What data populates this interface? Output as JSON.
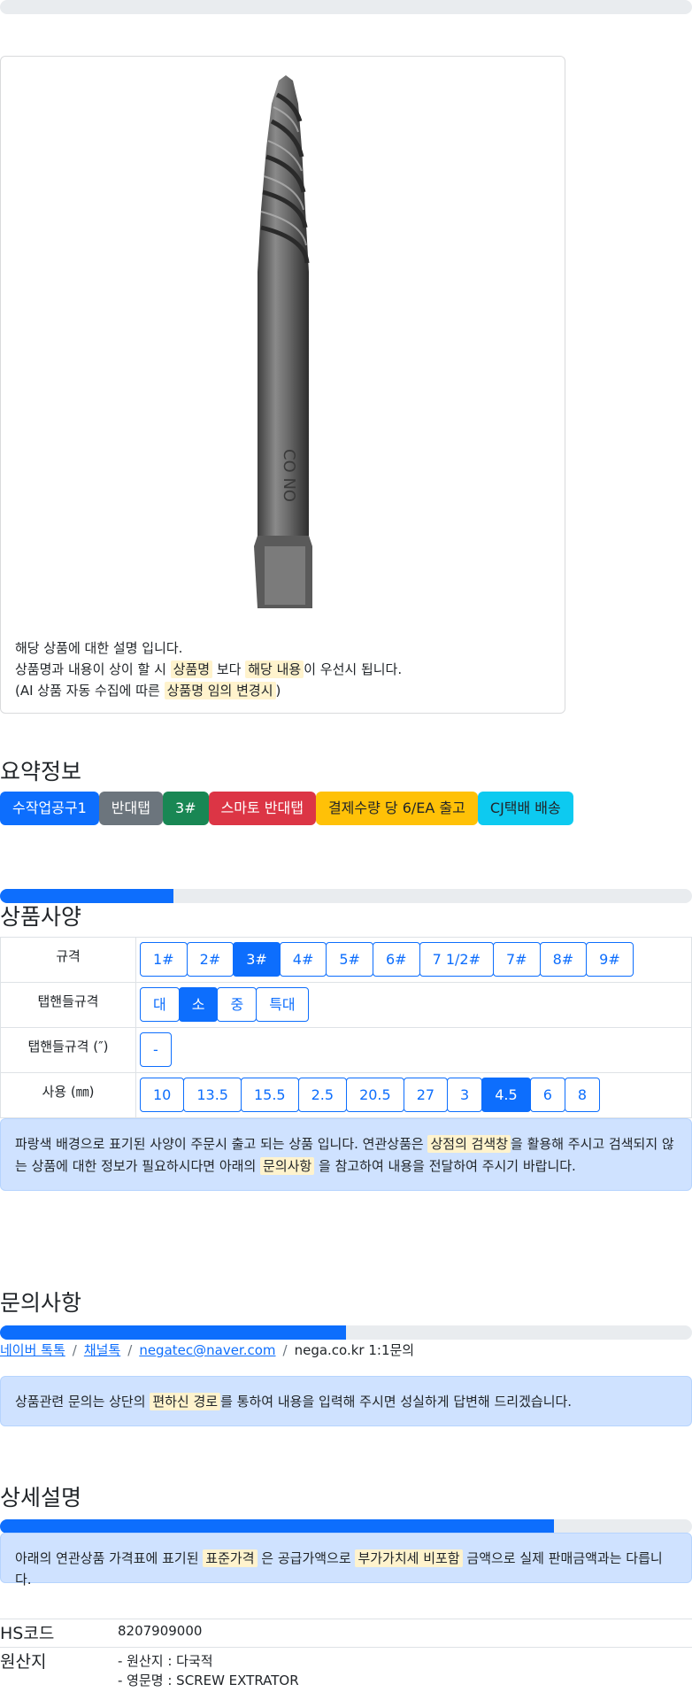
{
  "product": {
    "desc_line1": "해당 상품에 대한 설명 입니다.",
    "desc_line2_a": "상품명과 내용이 상이 할 시",
    "desc_line2_mark1": "상품명",
    "desc_line2_b": "보다",
    "desc_line2_mark2": "해당 내용",
    "desc_line2_c": "이 우선시 됩니다.",
    "desc_line3_a": "(AI 상품 자동 수집에 따른",
    "desc_line3_mark": "상품명 임의 변경시",
    "desc_line3_b": ")"
  },
  "summary": {
    "title": "요약정보",
    "badges": [
      {
        "label": "수작업공구1",
        "color": "#0d6efd",
        "text": "#ffffff"
      },
      {
        "label": "반대탭",
        "color": "#6c757d",
        "text": "#ffffff"
      },
      {
        "label": "3#",
        "color": "#198754",
        "text": "#ffffff"
      },
      {
        "label": "스마토 반대탭",
        "color": "#dc3545",
        "text": "#ffffff"
      },
      {
        "label": "결제수량 당 6/EA 출고",
        "color": "#ffc107",
        "text": "#212529"
      },
      {
        "label": "CJ택배 배송",
        "color": "#0dcaf0",
        "text": "#212529"
      }
    ]
  },
  "specs": {
    "title": "상품사양",
    "progress": 0.25,
    "rows": [
      {
        "label": "규격",
        "options": [
          "1#",
          "2#",
          "3#",
          "4#",
          "5#",
          "6#",
          "7 1/2#",
          "7#",
          "8#",
          "9#"
        ],
        "selected": 2
      },
      {
        "label": "탭핸들규격",
        "options": [
          "대",
          "소",
          "중",
          "특대"
        ],
        "selected": 1
      },
      {
        "label": "탭핸들규격 (″)",
        "options": [
          "-"
        ],
        "selected": -1
      },
      {
        "label": "사용 (㎜)",
        "options": [
          "10",
          "13.5",
          "15.5",
          "2.5",
          "20.5",
          "27",
          "3",
          "4.5",
          "6",
          "8"
        ],
        "selected": 7
      }
    ],
    "notice_a": "파랑색 배경으로 표기된 사양이 주문시 출고 되는 상품 입니다. 연관상품은",
    "notice_mark1": "상점의 검색창",
    "notice_b": "을 활용해 주시고 검색되지 않는 상품에 대한 정보가 필요하시다면 아래의",
    "notice_mark2": "문의사항",
    "notice_c": "을 참고하여 내용을 전달하여 주시기 바랍니다."
  },
  "inquiry": {
    "title": "문의사항",
    "progress": 0.5,
    "links": [
      "네이버 톡톡",
      "채널톡",
      "negatec@naver.com"
    ],
    "plain": "nega.co.kr 1:1문의",
    "notice_a": "상품관련 문의는 상단의",
    "notice_mark": "편하신 경로",
    "notice_b": "를 통하여 내용을 입력해 주시면 성실하게 답변해 드리겠습니다."
  },
  "detail": {
    "title": "상세설명",
    "progress": 0.8,
    "notice_a": "아래의 연관상품 가격표에 표기된",
    "notice_mark1": "표준가격",
    "notice_b": "은 공급가액으로",
    "notice_mark2": "부가가치세 비포함",
    "notice_c": "금액으로 실제 판매금액과는 다릅니다.",
    "hs_label": "HS코드",
    "hs_value": "8207909000",
    "origin_label": "원산지",
    "origin_line1": "- 원산지 : 다국적",
    "origin_line2": "- 영문명 : SCREW EXTRATOR"
  }
}
